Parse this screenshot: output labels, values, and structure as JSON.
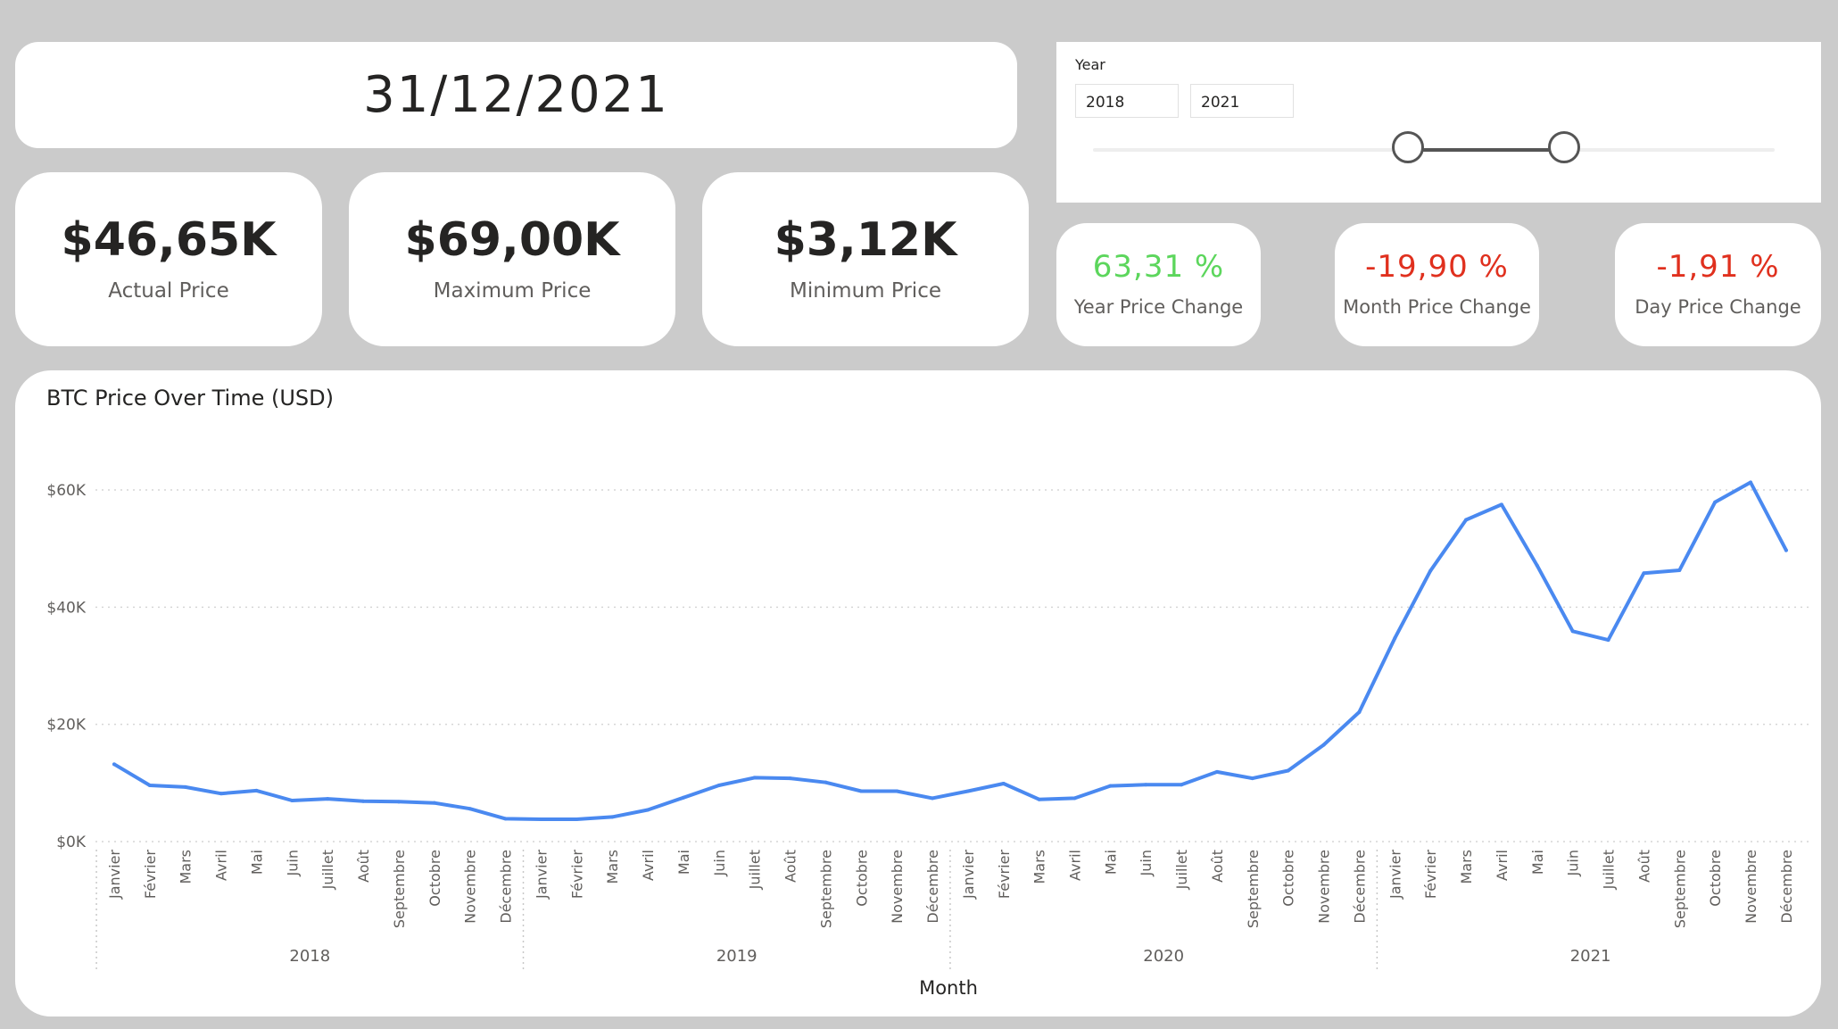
{
  "date": "31/12/2021",
  "kpis": {
    "actual": {
      "value": "$46,65K",
      "label": "Actual Price"
    },
    "maximum": {
      "value": "$69,00K",
      "label": "Maximum Price"
    },
    "minimum": {
      "value": "$3,12K",
      "label": "Minimum Price"
    }
  },
  "changes": {
    "year": {
      "value": "63,31 %",
      "label": "Year Price Change",
      "color": "#5cd65c"
    },
    "month": {
      "value": "-19,90 %",
      "label": "Month Price Change",
      "color": "#e0301e"
    },
    "day": {
      "value": "-1,91 %",
      "label": "Day Price Change",
      "color": "#e0301e"
    }
  },
  "slicer": {
    "title": "Year",
    "from": "2018",
    "to": "2021",
    "from_value": 2018,
    "to_value": 2021
  },
  "colors": {
    "line": "#4a89f0",
    "background": "#cbcbcb",
    "card": "#ffffff"
  },
  "chart_data": {
    "type": "line",
    "title": "BTC Price Over Time (USD)",
    "xlabel": "Month",
    "ylabel": "",
    "ylim": [
      0,
      60000
    ],
    "yticks": [
      "$0K",
      "$20K",
      "$40K",
      "$60K"
    ],
    "ytick_values": [
      0,
      20000,
      40000,
      60000
    ],
    "grid": true,
    "months": [
      "Janvier",
      "Février",
      "Mars",
      "Avril",
      "Mai",
      "Juin",
      "Juillet",
      "Août",
      "Septembre",
      "Octobre",
      "Novembre",
      "Décembre"
    ],
    "years": [
      "2018",
      "2019",
      "2020",
      "2021"
    ],
    "series": [
      {
        "values": [
          13200,
          9600,
          9300,
          8200,
          8700,
          7000,
          7300,
          6900,
          6800,
          6600,
          5600,
          3900,
          3800,
          3800,
          4200,
          5400,
          7500,
          9600,
          10900,
          10800,
          10100,
          8600,
          8600,
          7400,
          8600,
          9900,
          7200,
          7400,
          9500,
          9700,
          9700,
          11900,
          10800,
          12100,
          16500,
          22100,
          34700,
          46200,
          54900,
          57500,
          47100,
          35900,
          34400,
          45800,
          46300,
          57900,
          61300,
          49700
        ]
      }
    ]
  }
}
